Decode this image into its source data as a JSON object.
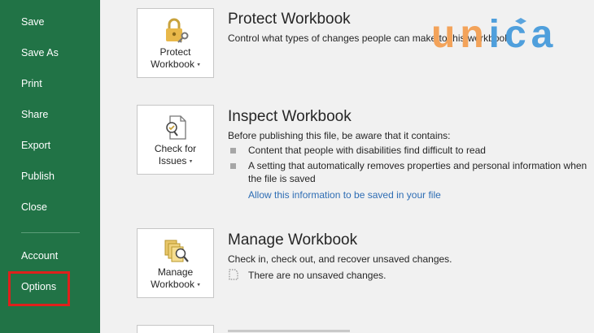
{
  "sidebar": {
    "items": [
      {
        "label": "Save"
      },
      {
        "label": "Save As"
      },
      {
        "label": "Print"
      },
      {
        "label": "Share"
      },
      {
        "label": "Export"
      },
      {
        "label": "Publish"
      },
      {
        "label": "Close"
      },
      {
        "label": "Account"
      },
      {
        "label": "Options"
      }
    ]
  },
  "protect": {
    "button_line1": "Protect",
    "button_line2": "Workbook",
    "title": "Protect Workbook",
    "description": "Control what types of changes people can make to this workbook."
  },
  "inspect": {
    "button_line1": "Check for",
    "button_line2": "Issues",
    "title": "Inspect Workbook",
    "description": "Before publishing this file, be aware that it contains:",
    "bullet1": "Content that people with disabilities find difficult to read",
    "bullet2_line1": "A setting that automatically removes properties and personal information when",
    "bullet2_line2": "the file is saved",
    "link": "Allow this information to be saved in your file"
  },
  "manage": {
    "button_line1": "Manage",
    "button_line2": "Workbook",
    "title": "Manage Workbook",
    "description": "Check in, check out, and recover unsaved changes.",
    "status": "There are no unsaved changes."
  },
  "watermark": {
    "text": "unica"
  },
  "colors": {
    "sidebar": "#217346",
    "highlight": "#e0201c",
    "link": "#2e6db4"
  }
}
